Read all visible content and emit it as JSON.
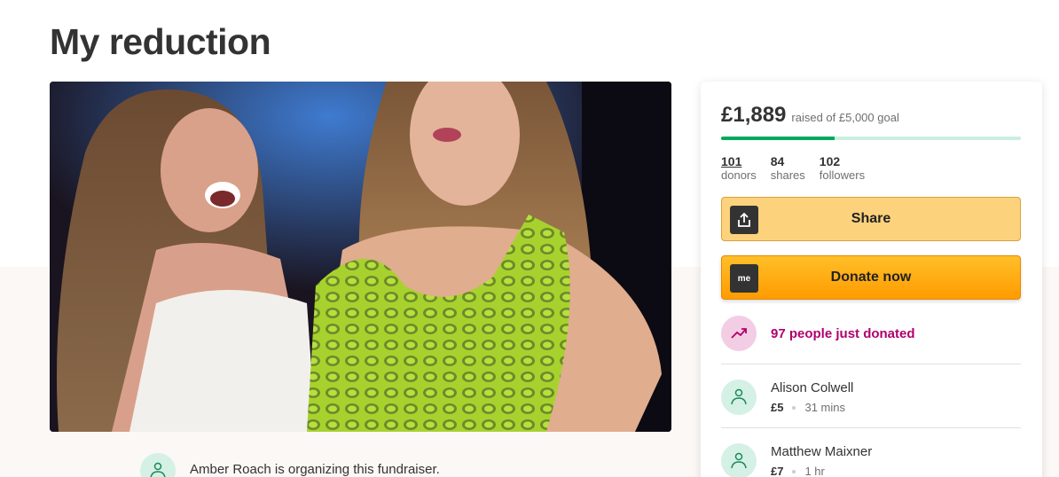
{
  "page": {
    "title": "My reduction"
  },
  "organizer": {
    "text": "Amber Roach is organizing this fundraiser."
  },
  "campaign": {
    "raised": "£1,889",
    "goal_text": "raised of £5,000 goal",
    "progress_fraction": 0.378,
    "stats": [
      {
        "value": "101",
        "label": "donors"
      },
      {
        "value": "84",
        "label": "shares"
      },
      {
        "value": "102",
        "label": "followers"
      }
    ]
  },
  "buttons": {
    "share_label": "Share",
    "donate_label": "Donate now",
    "donate_icon_text": "me"
  },
  "activity": {
    "just_donated": "97 people just donated"
  },
  "donations": [
    {
      "name": "Alison Colwell",
      "amount": "£5",
      "time": "31 mins"
    },
    {
      "name": "Matthew Maixner",
      "amount": "£7",
      "time": "1 hr"
    }
  ],
  "colors": {
    "accent_green": "#02a95c",
    "progress_track": "#c8efdf",
    "share_button": "#fdd27c",
    "donate_button": "#ff9b00",
    "trend_pink": "#b1006d"
  },
  "icons": {
    "share": "share-upload-icon",
    "donate": "gofundme-logo-icon",
    "trend": "trending-up-icon",
    "donor": "heart-hand-icon"
  }
}
